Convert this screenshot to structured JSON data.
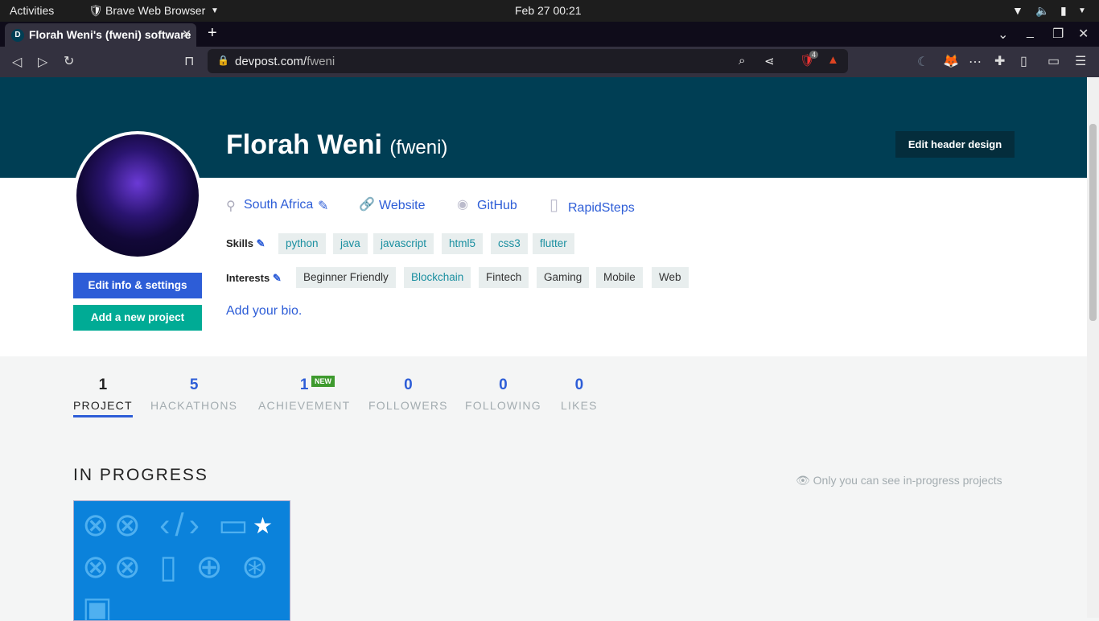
{
  "system": {
    "activities": "Activities",
    "app": "Brave Web Browser",
    "clock": "Feb 27  00:21"
  },
  "browser": {
    "tab_title": "Florah Weni's (fweni) software",
    "tab_favicon": "D",
    "url_host": "devpost.com/",
    "url_path": "fweni",
    "shields_count": "4"
  },
  "profile": {
    "name": "Florah Weni",
    "username": "(fweni)",
    "edit_header": "Edit header design",
    "location": "South Africa",
    "website": "Website",
    "github": "GitHub",
    "rapidsteps": "RapidSteps",
    "skills_label": "Skills",
    "skills": [
      "python",
      "java",
      "javascript",
      "html5",
      "css3",
      "flutter"
    ],
    "interests_label": "Interests",
    "interests": [
      "Beginner Friendly",
      "Blockchain",
      "Fintech",
      "Gaming",
      "Mobile",
      "Web"
    ],
    "edit_info": "Edit info & settings",
    "add_project": "Add a new project",
    "bio": "Add your bio."
  },
  "stats": [
    {
      "n": "1",
      "l": "PROJECT"
    },
    {
      "n": "5",
      "l": "HACKATHONS"
    },
    {
      "n": "1",
      "l": "ACHIEVEMENT"
    },
    {
      "n": "0",
      "l": "FOLLOWERS"
    },
    {
      "n": "0",
      "l": "FOLLOWING"
    },
    {
      "n": "0",
      "l": "LIKES"
    }
  ],
  "new_badge": "NEW",
  "in_progress": {
    "title": "IN PROGRESS",
    "note": "Only you can see in-progress projects"
  }
}
